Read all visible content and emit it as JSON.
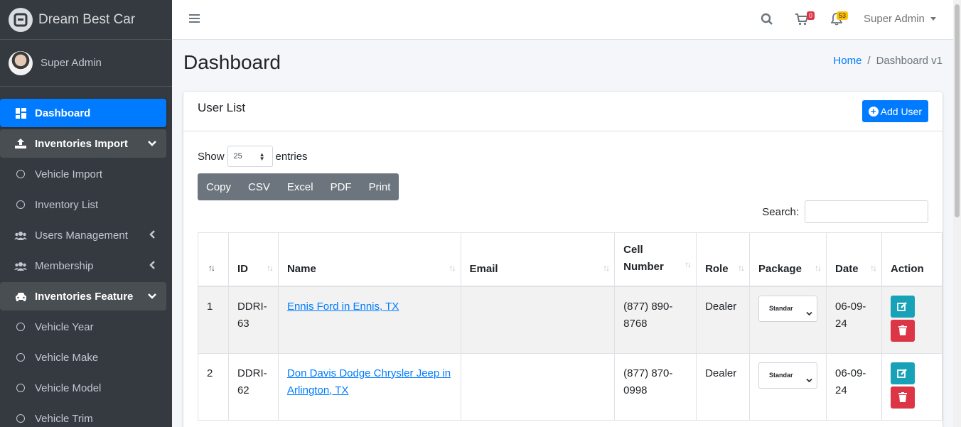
{
  "brand": {
    "name": "Dream Best Car"
  },
  "user": {
    "name": "Super Admin"
  },
  "sidebar": {
    "items": [
      {
        "label": "Dashboard"
      },
      {
        "label": "Inventories Import"
      },
      {
        "label": "Vehicle Import"
      },
      {
        "label": "Inventory List"
      },
      {
        "label": "Users Management"
      },
      {
        "label": "Membership"
      },
      {
        "label": "Inventories Feature"
      },
      {
        "label": "Vehicle Year"
      },
      {
        "label": "Vehicle Make"
      },
      {
        "label": "Vehicle Model"
      },
      {
        "label": "Vehicle Trim"
      }
    ]
  },
  "header": {
    "cart_count": "0",
    "notif_count": "53",
    "admin_label": "Super Admin"
  },
  "page": {
    "title": "Dashboard",
    "breadcrumb": {
      "home": "Home",
      "sep": "/",
      "current": "Dashboard v1"
    }
  },
  "card": {
    "title": "User List",
    "add_button": "Add User"
  },
  "table_controls": {
    "show_label": "Show",
    "entries_value": "25",
    "entries_label": "entries",
    "export_buttons": [
      "Copy",
      "CSV",
      "Excel",
      "PDF",
      "Print"
    ],
    "search_label": "Search:"
  },
  "table": {
    "headers": [
      "",
      "ID",
      "Name",
      "Email",
      "Cell Number",
      "Role",
      "Package",
      "Date",
      "Action"
    ],
    "rows": [
      {
        "num": "1",
        "id": "DDRI-63",
        "name": "Ennis Ford in Ennis, TX",
        "email": "",
        "cell": "(877) 890-8768",
        "role": "Dealer",
        "package": "Standar",
        "date": "06-09-24"
      },
      {
        "num": "2",
        "id": "DDRI-62",
        "name": "Don Davis Dodge Chrysler Jeep in Arlington, TX",
        "email": "",
        "cell": "(877) 870-0998",
        "role": "Dealer",
        "package": "Standar",
        "date": "06-09-24"
      }
    ]
  },
  "colors": {
    "primary": "#007bff",
    "sidebar_bg": "#343a40",
    "edit": "#17a2b8",
    "delete": "#dc3545",
    "export_group": "#6c757d"
  }
}
